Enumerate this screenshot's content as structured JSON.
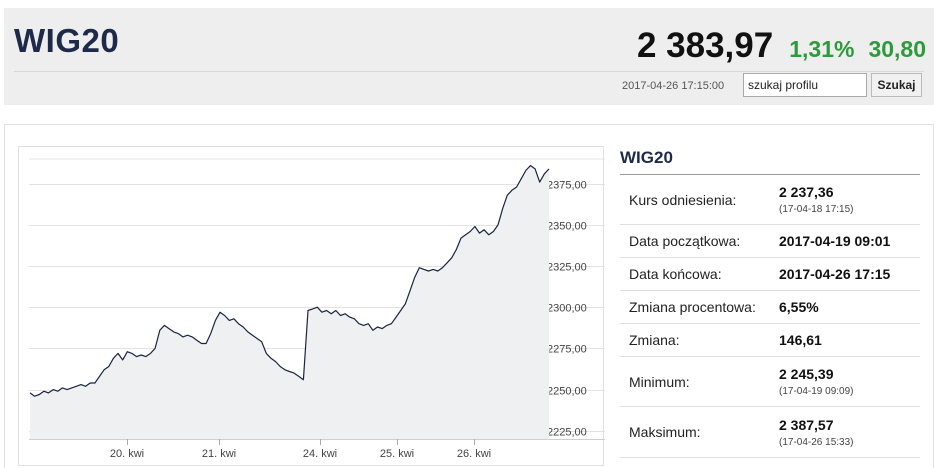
{
  "header": {
    "index_name": "WIG20",
    "price": "2 383,97",
    "change_pct": "1,31%",
    "change_abs": "30,80",
    "timestamp": "2017-04-26 17:15:00",
    "accent_color": "#1e2a4a",
    "up_color": "#2e9a3c"
  },
  "search": {
    "value": "szukaj profilu",
    "button_label": "Szukaj"
  },
  "info": {
    "title": "WIG20",
    "rows": [
      {
        "label": "Kurs odniesienia:",
        "value": "2 237,36",
        "sub": "(17-04-18 17:15)"
      },
      {
        "label": "Data początkowa:",
        "value": "2017-04-19 09:01",
        "sub": ""
      },
      {
        "label": "Data końcowa:",
        "value": "2017-04-26 17:15",
        "sub": ""
      },
      {
        "label": "Zmiana procentowa:",
        "value": "6,55%",
        "sub": ""
      },
      {
        "label": "Zmiana:",
        "value": "146,61",
        "sub": ""
      },
      {
        "label": "Minimum:",
        "value": "2 245,39",
        "sub": "(17-04-19 09:09)"
      },
      {
        "label": "Maksimum:",
        "value": "2 387,57",
        "sub": "(17-04-26 15:33)"
      }
    ]
  },
  "chart_data": {
    "type": "area",
    "x_ticks": [
      "20. kwi",
      "21. kwi",
      "24. kwi",
      "25. kwi",
      "26. kwi"
    ],
    "y_ticks": [
      "2375,00",
      "2350,00",
      "2325,00",
      "2300,00",
      "2275,00",
      "2250,00",
      "2225,00"
    ],
    "y_tick_values": [
      2375,
      2350,
      2325,
      2300,
      2275,
      2250,
      2225
    ],
    "ylim": [
      2220,
      2390
    ],
    "grid": true,
    "line_color": "#1a2540",
    "fill_color": "#eef0f2",
    "sessions": [
      "19. kwi",
      "20. kwi",
      "21. kwi",
      "24. kwi",
      "25. kwi",
      "26. kwi"
    ],
    "series": [
      {
        "values": [
          2248,
          2246,
          2247,
          2249,
          2248,
          2250,
          2249,
          2251,
          2250,
          2251,
          2252,
          2253,
          2252,
          2254,
          2254,
          2258,
          2262,
          2264,
          2269,
          2272,
          2268,
          2273,
          2272,
          2270,
          2271,
          2270,
          2272,
          2275,
          2286,
          2289,
          2287,
          2285,
          2284,
          2282,
          2283,
          2282,
          2280,
          2278,
          2278,
          2284,
          2292,
          2297,
          2295,
          2292,
          2293,
          2290,
          2288,
          2285,
          2283,
          2281,
          2279,
          2272,
          2269,
          2267,
          2264,
          2262,
          2261,
          2260,
          2258,
          2256,
          2298,
          2299,
          2300,
          2297,
          2298,
          2296,
          2298,
          2295,
          2296,
          2294,
          2293,
          2290,
          2289,
          2290,
          2286,
          2288,
          2287,
          2289,
          2290,
          2294,
          2298,
          2302,
          2310,
          2318,
          2324,
          2323,
          2322,
          2323,
          2322,
          2324,
          2327,
          2330,
          2335,
          2342,
          2344,
          2346,
          2349,
          2345,
          2347,
          2344,
          2346,
          2350,
          2360,
          2368,
          2371,
          2373,
          2378,
          2383,
          2386,
          2384,
          2376,
          2381,
          2384
        ]
      }
    ]
  }
}
